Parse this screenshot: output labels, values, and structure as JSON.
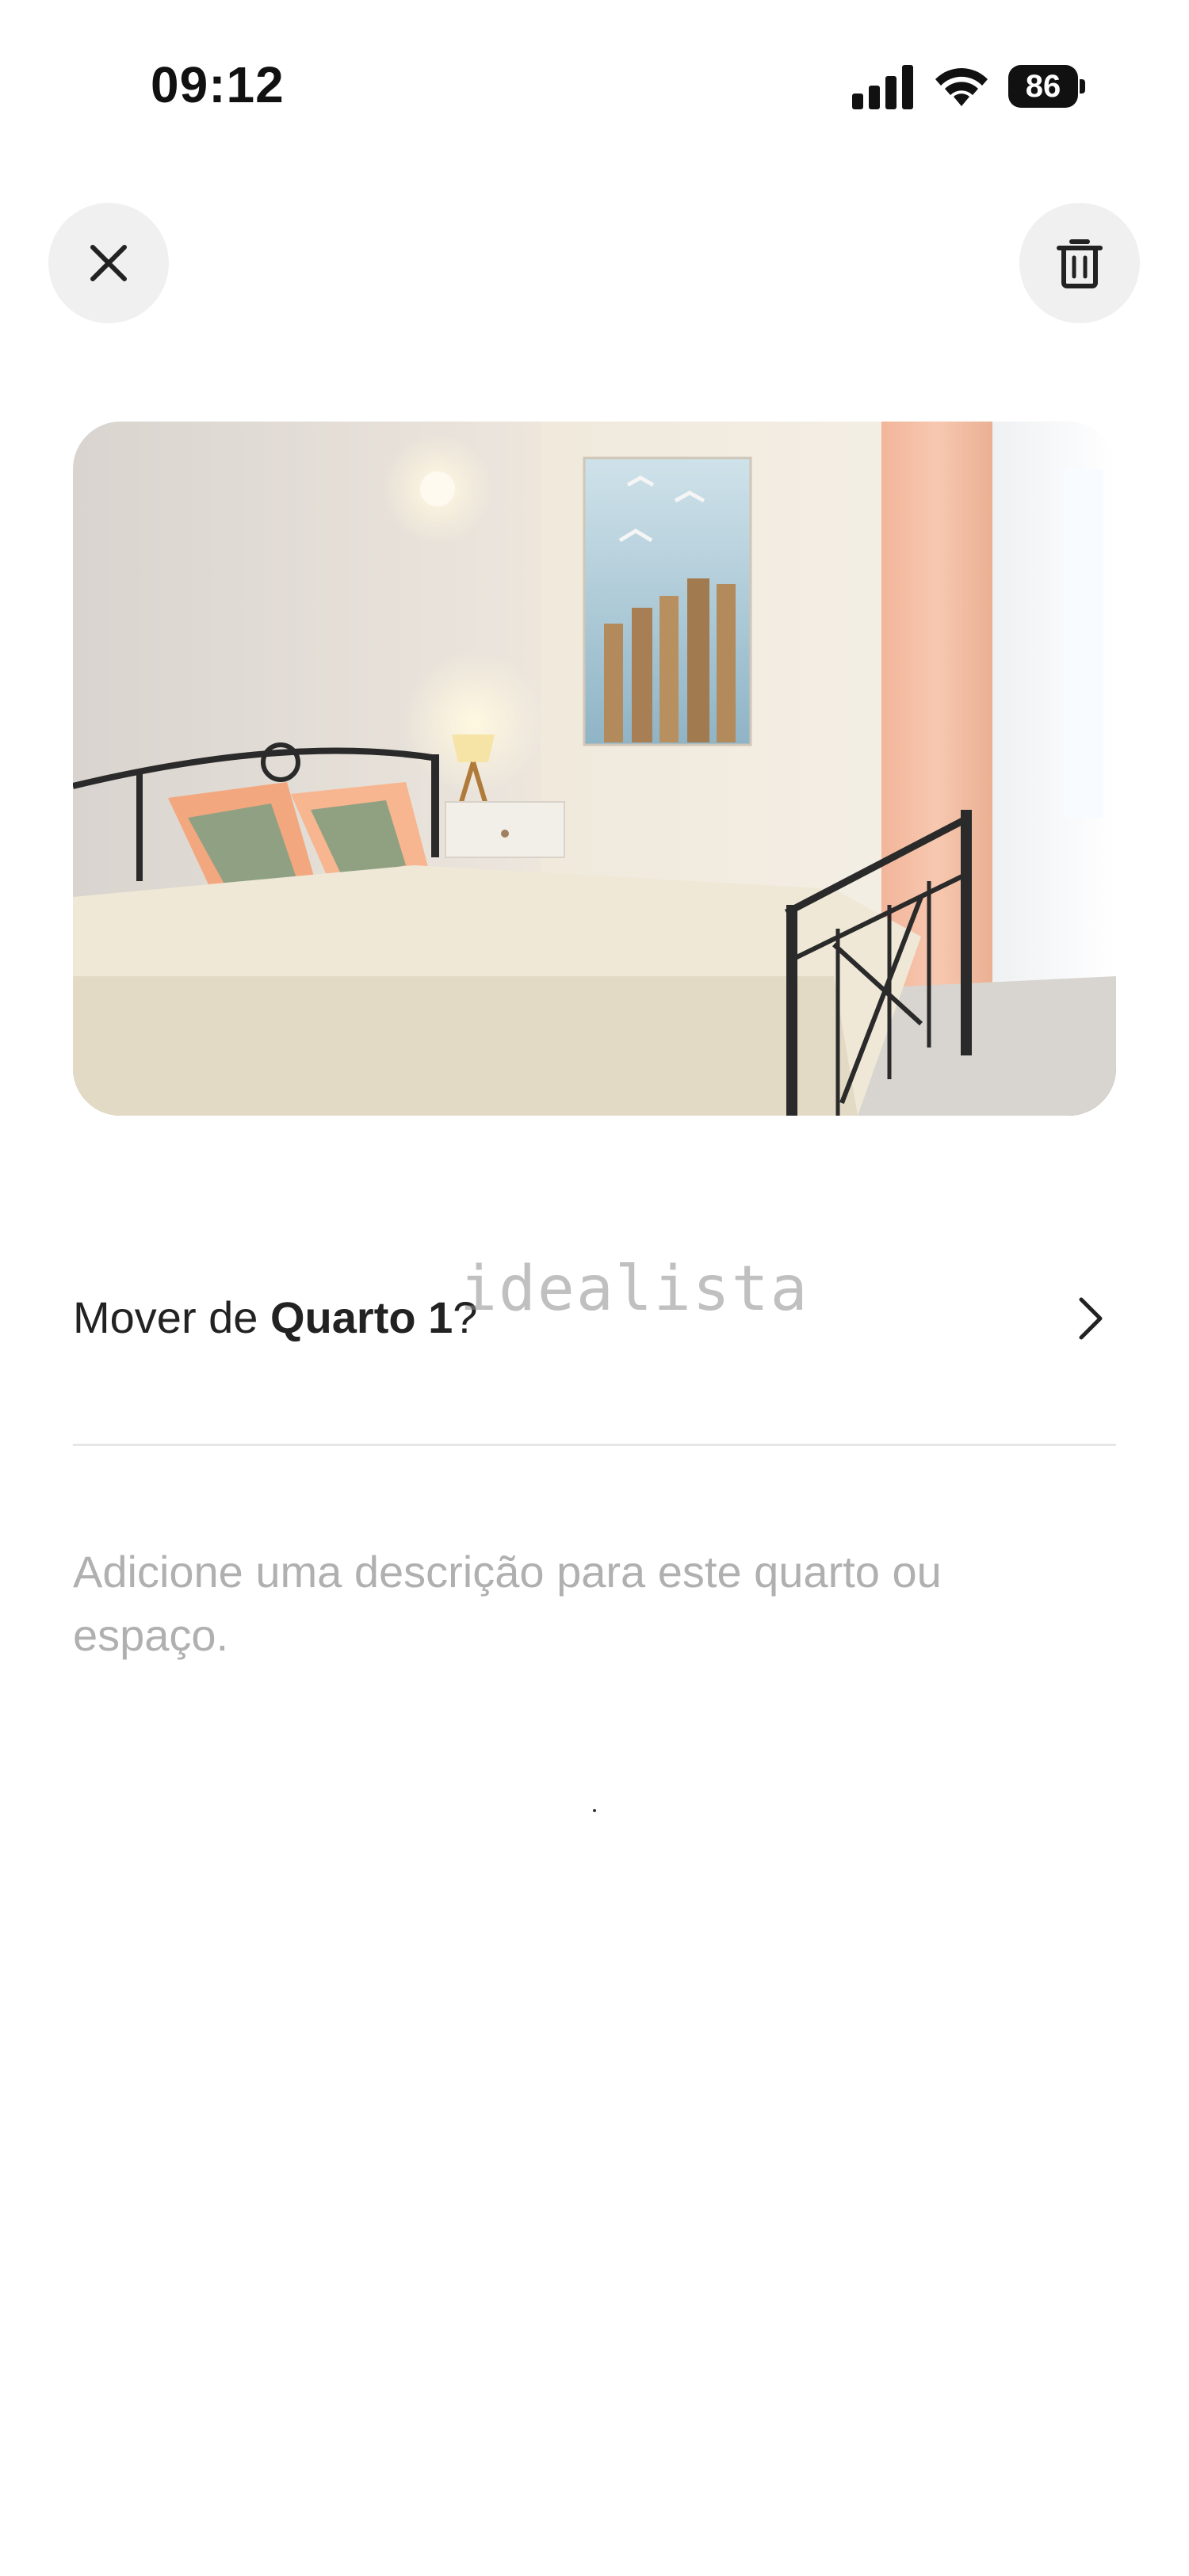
{
  "status_bar": {
    "time": "09:12",
    "battery_level": "86",
    "icons": [
      "cellular-signal-icon",
      "wifi-icon",
      "battery-icon"
    ]
  },
  "header": {
    "close_icon": "close-icon",
    "delete_icon": "trash-icon"
  },
  "photo": {
    "subject": "bedroom-photo"
  },
  "watermark": {
    "text": "idealista"
  },
  "move_row": {
    "prefix": "Mover de ",
    "room_name": "Quarto 1",
    "suffix": "?",
    "chevron_icon": "chevron-right-icon"
  },
  "description": {
    "placeholder": "Adicione uma descrição para este quarto ou espaço."
  },
  "colors": {
    "background": "#ffffff",
    "button_bg": "#f0f0f0",
    "text_primary": "#222222",
    "placeholder": "#b0b0b0",
    "divider": "#e6e6e6"
  }
}
